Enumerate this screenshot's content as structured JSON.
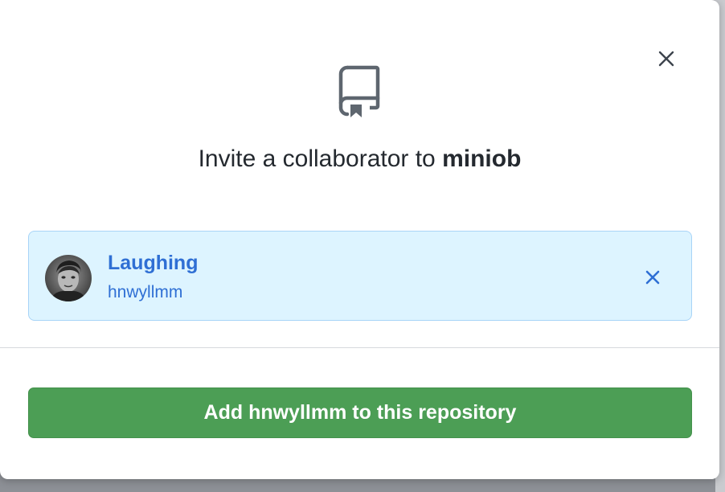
{
  "modal": {
    "title_prefix": "Invite a collaborator to ",
    "repo_name": "miniob",
    "close_icon": "close-icon",
    "repo_icon": "repo-icon"
  },
  "selected_user": {
    "full_name": "Laughing",
    "login": "hnwyllmm",
    "avatar_icon": "avatar",
    "remove_icon": "close-icon"
  },
  "actions": {
    "add_button_label": "Add hnwyllmm to this repository"
  },
  "colors": {
    "accent_blue": "#2f6fd4",
    "card_background": "#ddf4ff",
    "card_border": "#a8d4f7",
    "primary_button": "#4c9e55",
    "title_text": "#24292f"
  }
}
